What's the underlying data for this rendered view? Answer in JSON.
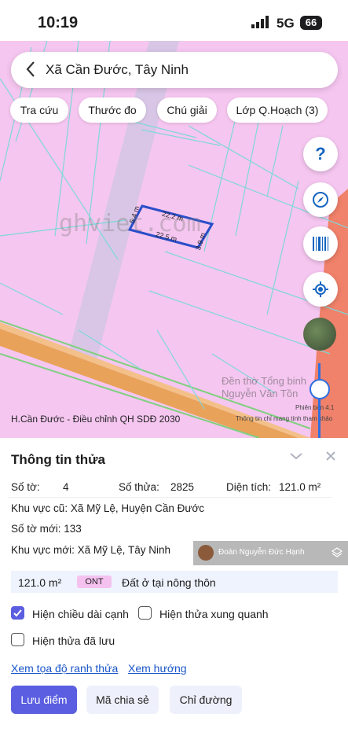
{
  "status_bar": {
    "time": "10:19",
    "network": "5G",
    "battery": "66"
  },
  "map": {
    "search_title": "Xã Cần Đước, Tây Ninh",
    "chips": [
      "Tra cứu",
      "Thước đo",
      "Chú giải",
      "Lớp Q.Hoạch (3)"
    ],
    "dimensions": {
      "top": "22.2 m",
      "bottom": "22.5 m",
      "left": "5.4 m",
      "right": "3.9 m"
    },
    "watermark": "ghviet.com",
    "plan_label": "H.Cần Đước - Điều chỉnh QH SDĐ 2030",
    "landmark": "Đền thờ Tổng binh Nguyễn Văn Tồn",
    "version": "Phiên bản 4.1",
    "disclaimer": "Thông tin chỉ mang tính tham khảo",
    "buttons": [
      "help-icon",
      "compass-icon",
      "barcode-icon",
      "locate-icon"
    ],
    "accent": "#1564c0"
  },
  "panel": {
    "title": "Thông tin thửa",
    "so_to_label": "Số tờ:",
    "so_to": "4",
    "so_thua_label": "Số thửa:",
    "so_thua": "2825",
    "dien_tich_label": "Diện tích:",
    "dien_tich": "121.0 m²",
    "kv_cu": "Khu vực cũ: Xã Mỹ Lệ, Huyện Cần Đước",
    "so_to_moi": "Số tờ mới: 133",
    "kv_moi": "Khu vực mới: Xã Mỹ Lệ, Tây Ninh",
    "overlay_user": "Đoàn Nguyễn Đức Hạnh",
    "use_area": "121.0 m²",
    "use_code": "ONT",
    "use_desc": "Đất ở tại nông thôn",
    "check_1": "Hiện chiều dài cạnh",
    "check_1_checked": true,
    "check_2": "Hiện thửa xung quanh",
    "check_3": "Hiện thửa đã lưu",
    "link_1": "Xem tọa độ ranh thửa",
    "link_2": "Xem hướng",
    "btn_save": "Lưu điểm",
    "btn_share": "Mã chia sẻ",
    "btn_route": "Chỉ đường",
    "primary_color": "#5b5ee0"
  }
}
